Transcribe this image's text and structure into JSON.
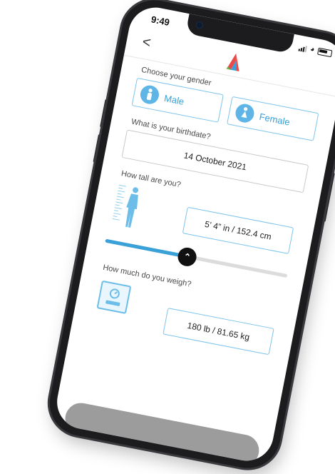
{
  "status_bar": {
    "time": "9:49"
  },
  "header": {
    "back_label": "<"
  },
  "gender": {
    "label": "Choose your gender",
    "options": [
      {
        "label": "Male",
        "icon": "male-icon"
      },
      {
        "label": "Female",
        "icon": "female-icon"
      }
    ],
    "accent": "#3aa0d8"
  },
  "birthdate": {
    "label": "What is your birthdate?",
    "value": "14 October 2021"
  },
  "height": {
    "label": "How tall are you?",
    "value": "5’ 4” in  /  152.4 cm",
    "slider_fraction": 0.45
  },
  "weight": {
    "label": "How much do you weigh?",
    "value": "180 lb  /  81.65 kg"
  },
  "colors": {
    "accent": "#3aa0d8",
    "border": "#7cc4ec",
    "track": "#dcdcdc",
    "thumb": "#111111"
  }
}
